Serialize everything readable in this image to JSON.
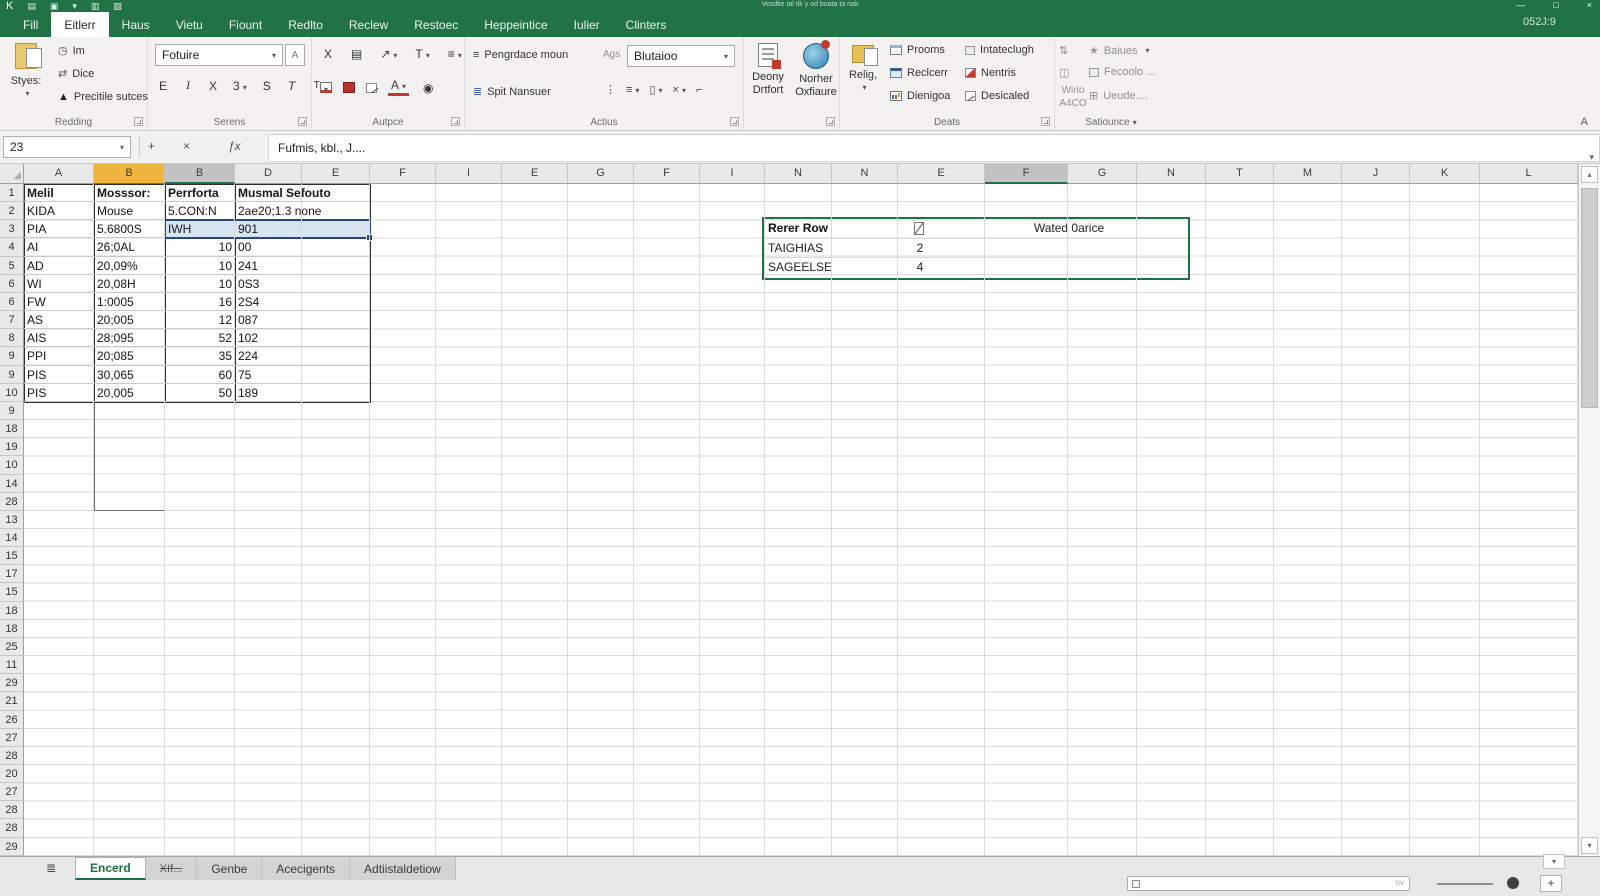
{
  "titlebar": {
    "app_letter": "K",
    "qat_glyphs": [
      "▤",
      "▣",
      "▾",
      "▥",
      "▧"
    ],
    "title": "Vesdtie tal tik y od boata ta nak",
    "clock": "052J:9",
    "min": "—",
    "max": "□",
    "close": "×"
  },
  "ribbon_tabs": {
    "active_index": 1,
    "tabs": [
      "Fill",
      "Eitlerr",
      "Haus",
      "Vietu",
      "Fiount",
      "Redlto",
      "Reclew",
      "Restoec",
      "Heppeintice",
      "Iulier",
      "Clinters"
    ]
  },
  "ribbon": {
    "redding": {
      "label": "Redding",
      "big_button": "Styes:",
      "items": [
        "Im",
        "Dice",
        "Precitile sutces"
      ]
    },
    "serens": {
      "label": "Serens",
      "font_name": "Fotuire",
      "buttons": [
        "E",
        "I",
        "X",
        "3",
        "S",
        "T",
        "T"
      ]
    },
    "autpce": {
      "label": "Autpce"
    },
    "actius": {
      "label": "Actius",
      "btn1": "Pengrdace moun",
      "btn2": "Spit Nansuer",
      "ags": "Ags",
      "dropdown": "Blutaioo"
    },
    "deony": {
      "btn1_line1": "Deony",
      "btn1_line2": "Drtfort",
      "btn2_line1": "Norher",
      "btn2_line2": "Oxfiaure"
    },
    "deats": {
      "label": "Deats",
      "big_button": "Relig,",
      "col1": [
        "Prooms",
        "Reclcerr",
        "Dienigoa"
      ],
      "col2": [
        "Intateclugh",
        "Nentris",
        "Desicaled"
      ]
    },
    "satiounce": {
      "label": "Satiounce",
      "wirio_line1": "Wirio",
      "wirio_line2": "A4CO",
      "items": [
        "Baiues",
        "Fecoolo ...",
        "Ueude...."
      ]
    },
    "corner_a": "A"
  },
  "formula_bar": {
    "name_box": "23",
    "formula": "Fufmis, kbl., J...."
  },
  "grid": {
    "columns": [
      {
        "letter": "A"
      },
      {
        "letter": "B",
        "hl": "orange"
      },
      {
        "letter": "B",
        "hl": "grayhl"
      },
      {
        "letter": "D"
      },
      {
        "letter": "E"
      },
      {
        "letter": "F"
      },
      {
        "letter": "I"
      },
      {
        "letter": "E"
      },
      {
        "letter": "G"
      },
      {
        "letter": "F"
      },
      {
        "letter": "I"
      },
      {
        "letter": "N"
      },
      {
        "letter": "N"
      },
      {
        "letter": "E"
      },
      {
        "letter": "F",
        "hl": "grayhl"
      },
      {
        "letter": "G"
      },
      {
        "letter": "N"
      },
      {
        "letter": "T"
      },
      {
        "letter": "M"
      },
      {
        "letter": "J"
      },
      {
        "letter": "K"
      },
      {
        "letter": "L"
      }
    ],
    "row_numbers": [
      "1",
      "2",
      "3",
      "4",
      "5",
      "6",
      "6",
      "7",
      "8",
      "9",
      "9",
      "10",
      "9",
      "18",
      "19",
      "10",
      "14",
      "28",
      "13",
      "14",
      "15",
      "17",
      "15",
      "18",
      "18",
      "25",
      "11",
      "29",
      "21",
      "26",
      "27",
      "28",
      "20",
      "27",
      "28",
      "28",
      "29",
      "26"
    ],
    "main_table": {
      "rows": [
        [
          "Melil",
          "Mosssor:",
          "Perrforta",
          "Musmal Sefouto"
        ],
        [
          "KIDA",
          "Mouse",
          "5.CON:N",
          "2ae20;1.3 none"
        ],
        [
          "PIA",
          "5.6800S",
          "IWH",
          "901"
        ],
        [
          "AI",
          "26;0AL",
          "10",
          "00"
        ],
        [
          "AD",
          "20,09%",
          "10",
          "241"
        ],
        [
          "WI",
          "20,08H",
          "10",
          "0S3"
        ],
        [
          "FW",
          "1:0005",
          "16",
          "2S4"
        ],
        [
          "AS",
          "20;005",
          "12",
          "087"
        ],
        [
          "AIS",
          "28;095",
          "52",
          "102"
        ],
        [
          "PPI",
          "20;085",
          "35",
          "224"
        ],
        [
          "PIS",
          "30,065",
          "60",
          "75"
        ],
        [
          "PIS",
          "20,005",
          "50",
          "189"
        ]
      ]
    },
    "side_table": {
      "title": "Rerer Row",
      "header_right": "Wated 0arice",
      "rows": [
        [
          "TAIGHIAS",
          "2"
        ],
        [
          "SAGEELSE",
          "4"
        ]
      ]
    }
  },
  "sheet_bar": {
    "tabs": [
      {
        "label": "Encerd",
        "active": true
      },
      {
        "label": "XIf...",
        "struck": true
      },
      {
        "label": "Genbe"
      },
      {
        "label": "Acecigents"
      },
      {
        "label": "Adtiistaldetiow"
      }
    ],
    "ov": "ov"
  },
  "icons": {
    "corner_tri": "◢",
    "clock": "◷",
    "dice": "⇄",
    "triangle": "▲",
    "font_extra": "A",
    "x_glyph": "X",
    "lines_glyph": "▤",
    "arrow_glyph": "↗",
    "t_glyph": "T",
    "list_glyph": "≡",
    "a_glyph": "A",
    "eye_glyph": "◉",
    "dots_glyph": "⋮",
    "box_glyph": "▯",
    "cancel_glyph": "×",
    "corner_glyph": "⌐",
    "plus_glyph": "+",
    "fx_glyph": "ƒx",
    "merge_glyph": "≡",
    "split_glyph": "≣",
    "sort_glyph": "⇅",
    "window_glyph": "◫",
    "star_glyph": "★",
    "grid_glyph": "⊞",
    "nav_glyph": "≣",
    "scroll_up": "▴",
    "scroll_down": "▾"
  },
  "colors": {
    "brand_green": "#217346",
    "table_green": "#1f7244",
    "selection_blue": "#27477e",
    "header_orange": "#f0b53e"
  }
}
